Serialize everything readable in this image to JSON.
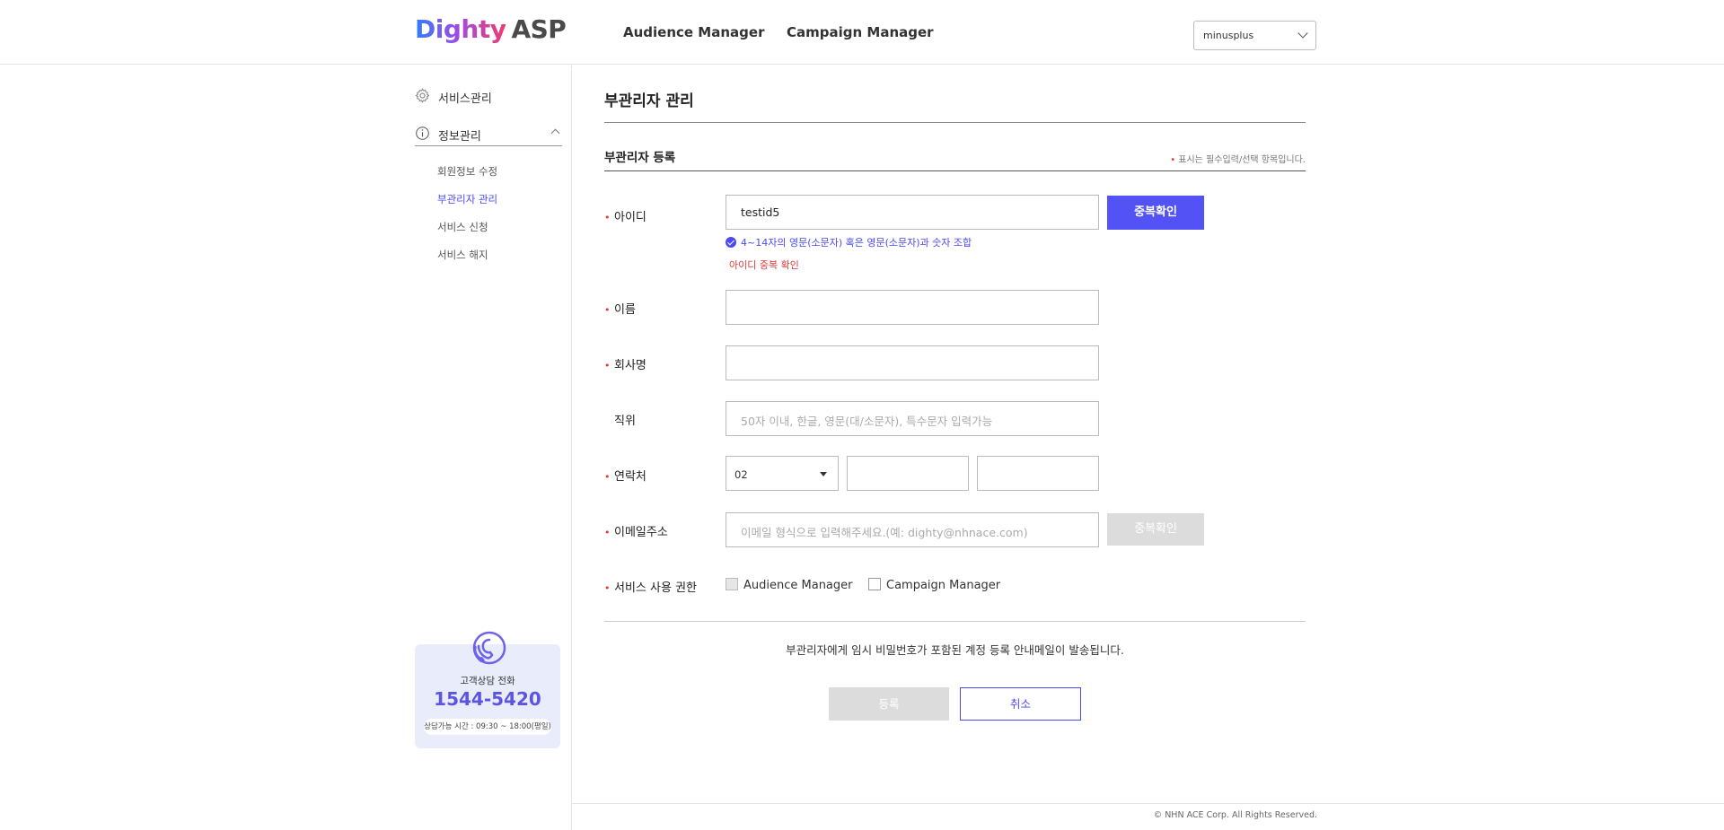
{
  "header": {
    "logo_brand": "Dighty",
    "logo_suffix": "ASP",
    "nav": [
      "Audience Manager",
      "Campaign Manager"
    ],
    "account_select": "minusplus",
    "brand_colors": {
      "primary": "#5352f5",
      "error": "#e23a3a"
    }
  },
  "sidebar": {
    "menus": [
      {
        "label": "서비스관리",
        "icon": "gear-icon"
      },
      {
        "label": "정보관리",
        "icon": "info-icon"
      }
    ],
    "sub_items": [
      {
        "label": "회원정보 수정",
        "active": false
      },
      {
        "label": "부관리자 관리",
        "active": true
      },
      {
        "label": "서비스 신청",
        "active": false
      },
      {
        "label": "서비스 해지",
        "active": false
      }
    ],
    "support": {
      "icon": "headset-phone-icon",
      "label": "고객상담 전화",
      "phone": "1544-5420",
      "hours": "상담가능 시간 : 09:30 ~ 18:00(평일)"
    }
  },
  "main": {
    "page_title": "부관리자 관리",
    "section_title": "부관리자 등록",
    "required_note_dot": "•",
    "required_note": "표시는 필수입력/선택 항목입니다.",
    "form": {
      "id": {
        "label": "아이디",
        "value": "testid5",
        "button": "중복확인",
        "hint": "4~14자의 영문(소문자) 혹은 영문(소문자)과 숫자 조합",
        "error": "아이디 중복 확인"
      },
      "name": {
        "label": "이름",
        "value": ""
      },
      "company": {
        "label": "회사명",
        "value": ""
      },
      "position": {
        "label": "직위",
        "placeholder": "50자 이내, 한글, 영문(대/소문자), 특수문자 입력가능"
      },
      "contact": {
        "label": "연락처",
        "area_code": "02",
        "part2": "",
        "part3": ""
      },
      "email": {
        "label": "이메일주소",
        "placeholder": "이메일 형식으로 입력해주세요.(예: dighty@nhnace.com)",
        "button": "중복확인"
      },
      "permission": {
        "label": "서비스 사용 권한",
        "options": [
          "Audience Manager",
          "Campaign Manager"
        ]
      }
    },
    "notice": "부관리자에게 임시 비밀번호가 포함된 계정 등록 안내메일이 발송됩니다.",
    "buttons": {
      "register": "등록",
      "cancel": "취소"
    }
  },
  "footer": {
    "copyright": "© NHN ACE Corp. All Rights Reserved."
  }
}
